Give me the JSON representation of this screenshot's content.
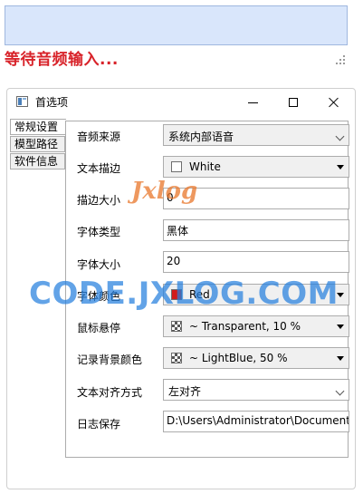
{
  "status_text": "等待音频输入...",
  "window": {
    "title": "首选项",
    "buttons": {
      "minimize": "minimize-icon",
      "maximize": "maximize-icon",
      "close": "close-icon"
    }
  },
  "tabs": [
    {
      "label": "常规设置",
      "selected": true
    },
    {
      "label": "模型路径",
      "selected": false
    },
    {
      "label": "软件信息",
      "selected": false
    }
  ],
  "settings": {
    "audio_source": {
      "label": "音频来源",
      "value": "系统内部语音"
    },
    "text_stroke": {
      "label": "文本描边",
      "value": "White",
      "swatch": "#ffffff"
    },
    "stroke_size": {
      "label": "描边大小",
      "value": "0"
    },
    "font_type": {
      "label": "字体类型",
      "value": "黑体"
    },
    "font_size": {
      "label": "字体大小",
      "value": "20"
    },
    "font_color": {
      "label": "字体颜色",
      "value": "Red",
      "swatch": "#d21a1a"
    },
    "hover": {
      "label": "鼠标悬停",
      "value": "~ Transparent, 10 %"
    },
    "record_bg": {
      "label": "记录背景颜色",
      "value": "~ LightBlue, 50 %"
    },
    "text_align": {
      "label": "文本对齐方式",
      "value": "左对齐"
    },
    "log_save": {
      "label": "日志保存",
      "value": "D:\\Users\\Administrator\\Documents"
    }
  },
  "watermark": {
    "text": "CODE.JXLOG.COM",
    "logo": "Jxlog"
  },
  "colors": {
    "status": "#d8232a",
    "top_box": "#d9e6fb",
    "watermark": "#2680de"
  }
}
